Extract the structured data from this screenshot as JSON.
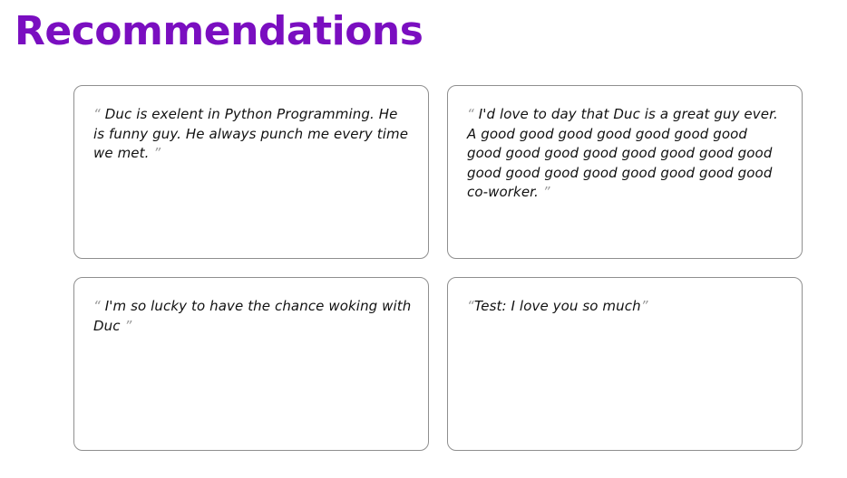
{
  "page": {
    "title": "Recommendations",
    "accent_color": "#7a0ec0"
  },
  "recommendations": [
    {
      "open_quote": "“ ",
      "text": "Duc is exelent in Python Programming. He is funny guy. He always punch me every time we met.",
      "close_quote": " ”"
    },
    {
      "open_quote": "“ ",
      "text": "I'd love to day that Duc is a great guy ever. A good good good good good good good good good good good good good good good good good good good good good good good co-worker.",
      "close_quote": " ”"
    },
    {
      "open_quote": "“ ",
      "text": "I'm so lucky to have the chance woking with Duc",
      "close_quote": " ”"
    },
    {
      "open_quote": "“",
      "text": "Test: I love you so much",
      "close_quote": "”"
    }
  ]
}
